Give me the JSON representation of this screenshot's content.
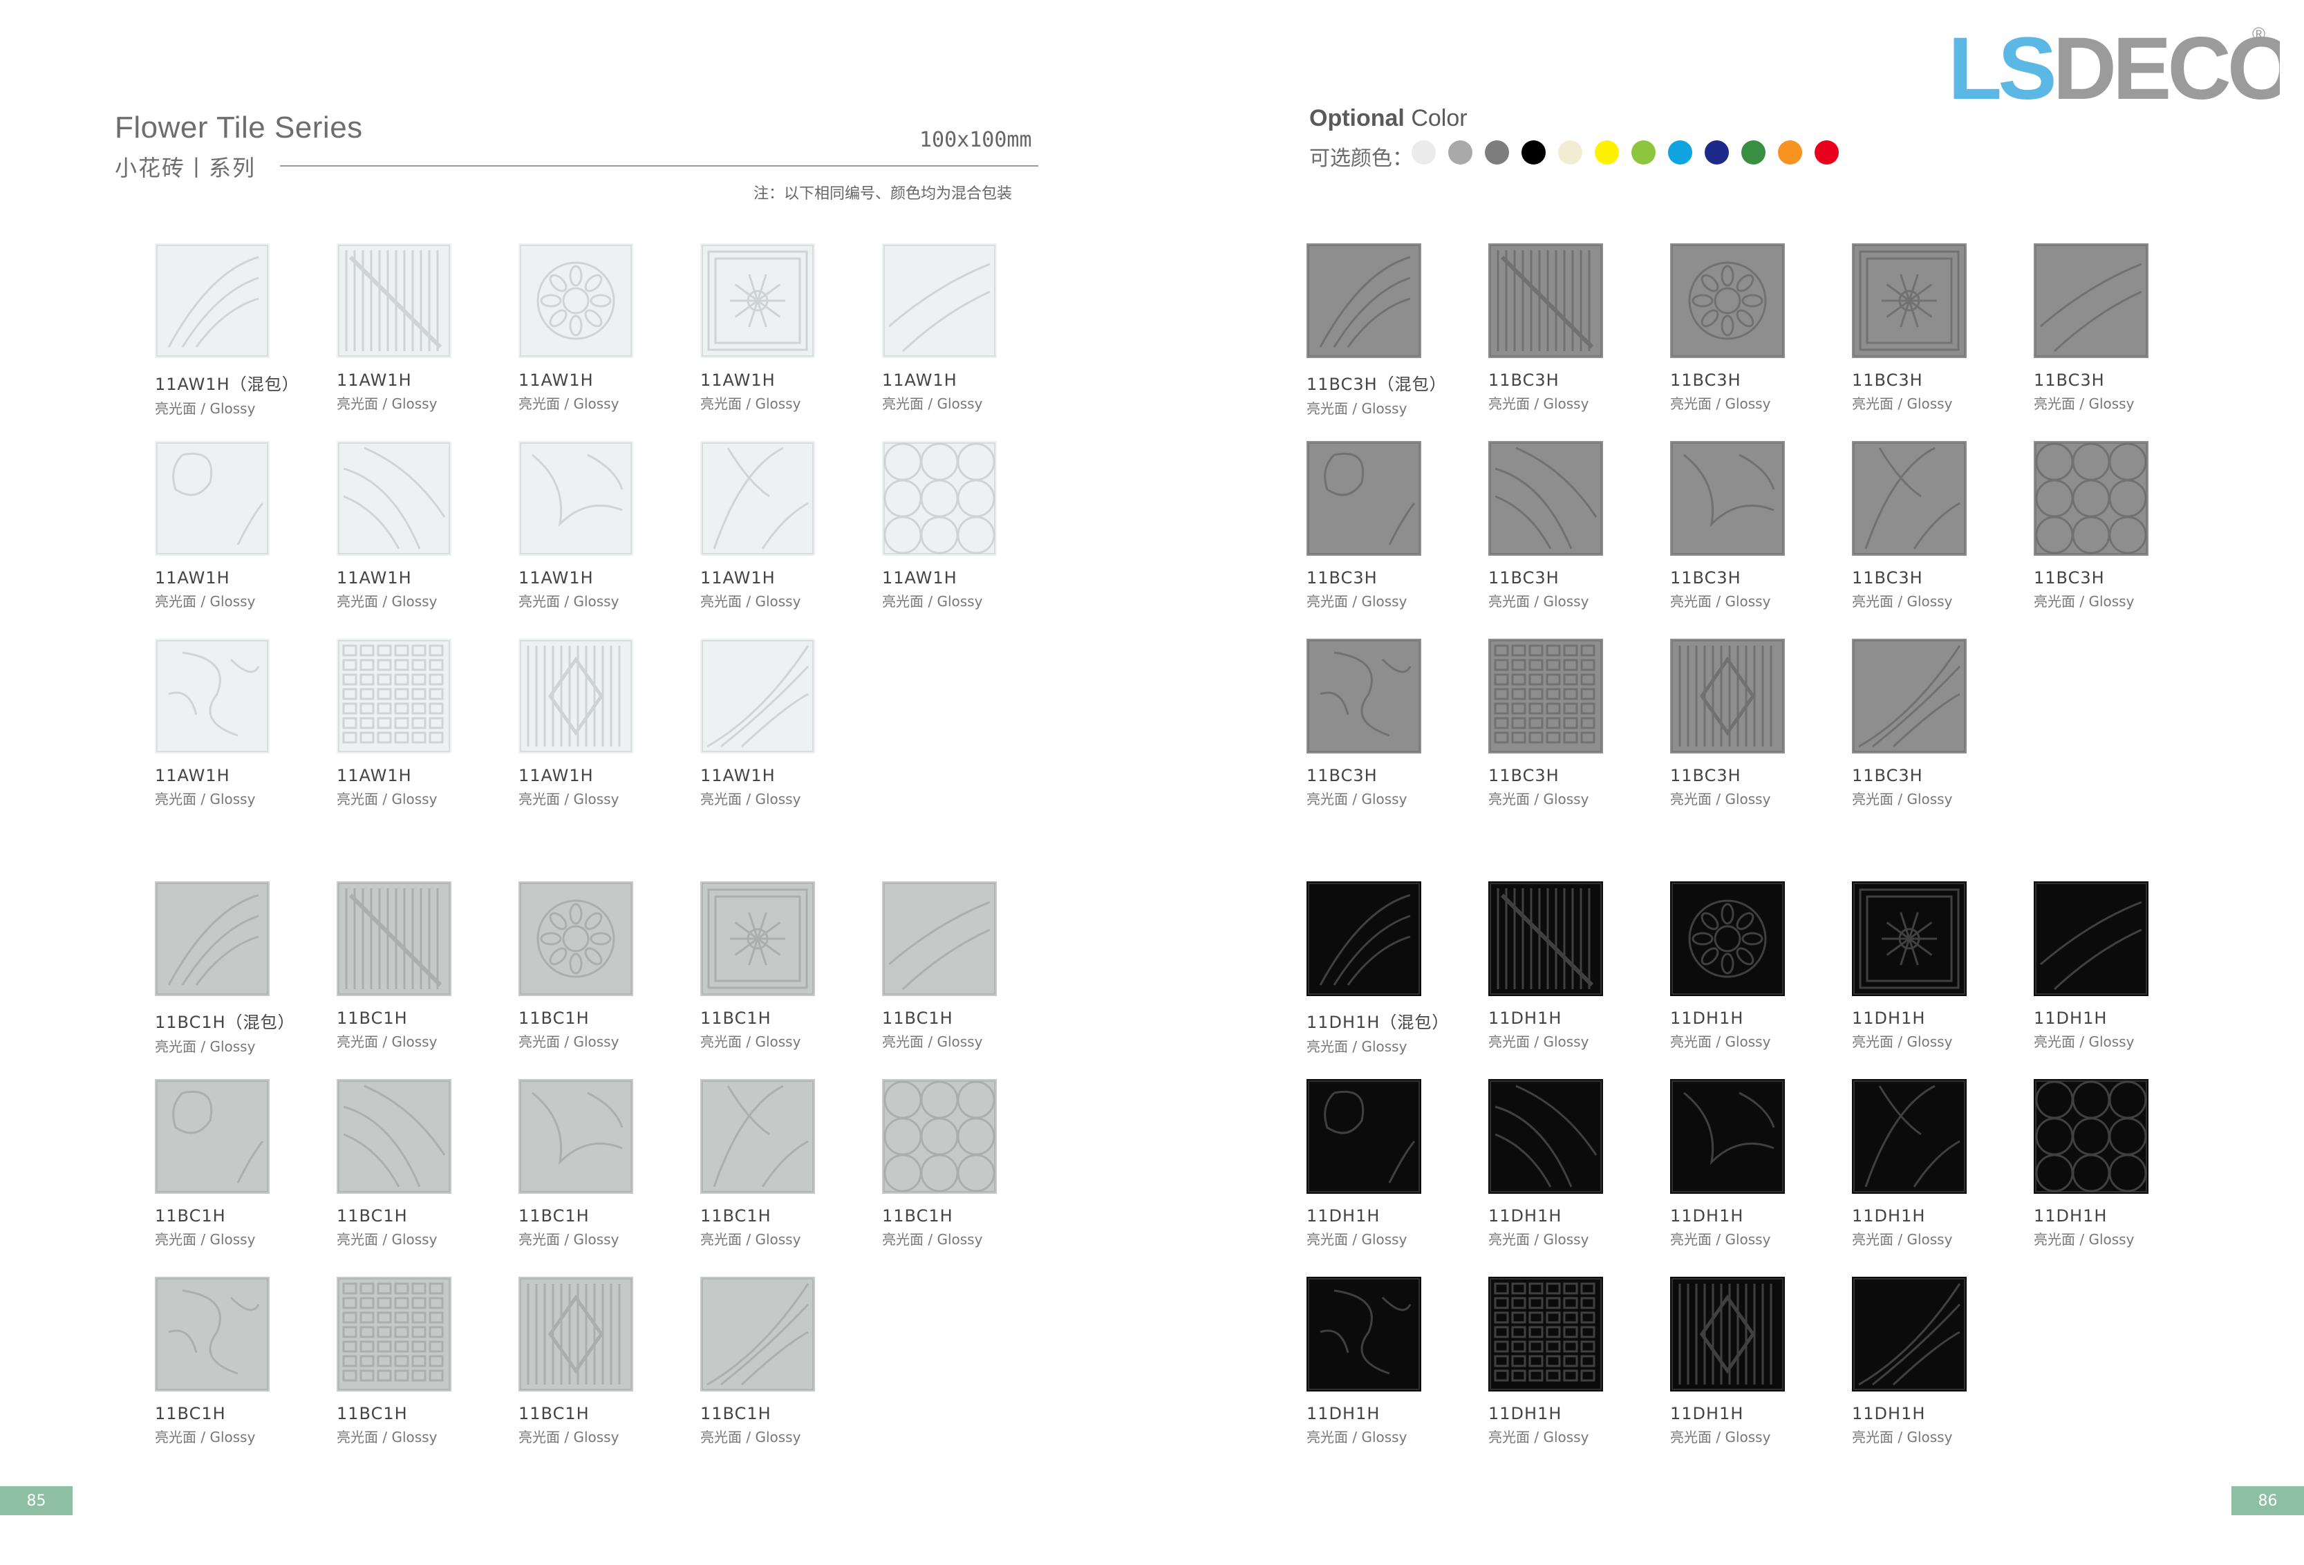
{
  "header": {
    "title_en": "Flower Tile Series",
    "title_cn": "小花砖丨系列",
    "size": "100x100mm",
    "note": "注：以下相同编号、颜色均为混合包装"
  },
  "optional_color": {
    "title_bold": "Optional",
    "title_rest": " Color",
    "label": "可选颜色：",
    "swatches": [
      "#ebebeb",
      "#a9a9a9",
      "#7d7d7d",
      "#000000",
      "#f3ecd2",
      "#fff200",
      "#8cc63f",
      "#0fa3e0",
      "#1e2a8a",
      "#3a8f43",
      "#f7931e",
      "#e8001c"
    ]
  },
  "logo": {
    "text": "LSDECO",
    "registered": "®",
    "color_letters": "#5bb8e5",
    "color_gray": "#9b9b9b"
  },
  "finish_label": "亮光面 / Glossy",
  "pages": {
    "left": "85",
    "right": "86"
  },
  "groups": [
    {
      "id": "aw",
      "tile_color": "#eef1f1",
      "pattern_color": "#c9d0d0",
      "rows": [
        [
          "11AW1H（混包）",
          "11AW1H",
          "11AW1H",
          "11AW1H",
          "11AW1H"
        ],
        [
          "11AW1H",
          "11AW1H",
          "11AW1H",
          "11AW1H",
          "11AW1H"
        ],
        [
          "11AW1H",
          "11AW1H",
          "11AW1H",
          "11AW1H"
        ]
      ]
    },
    {
      "id": "bc1",
      "tile_color": "#c5c9c8",
      "pattern_color": "#a6aaa9",
      "rows": [
        [
          "11BC1H（混包）",
          "11BC1H",
          "11BC1H",
          "11BC1H",
          "11BC1H"
        ],
        [
          "11BC1H",
          "11BC1H",
          "11BC1H",
          "11BC1H",
          "11BC1H"
        ],
        [
          "11BC1H",
          "11BC1H",
          "11BC1H",
          "11BC1H"
        ]
      ]
    },
    {
      "id": "bc3",
      "tile_color": "#8e8e8e",
      "pattern_color": "#6c6c6c",
      "rows": [
        [
          "11BC3H（混包）",
          "11BC3H",
          "11BC3H",
          "11BC3H",
          "11BC3H"
        ],
        [
          "11BC3H",
          "11BC3H",
          "11BC3H",
          "11BC3H",
          "11BC3H"
        ],
        [
          "11BC3H",
          "11BC3H",
          "11BC3H",
          "11BC3H"
        ]
      ]
    },
    {
      "id": "dh",
      "tile_color": "#0b0b0b",
      "pattern_color": "#4a4a4a",
      "rows": [
        [
          "11DH1H（混包）",
          "11DH1H",
          "11DH1H",
          "11DH1H",
          "11DH1H"
        ],
        [
          "11DH1H",
          "11DH1H",
          "11DH1H",
          "11DH1H",
          "11DH1H"
        ],
        [
          "11DH1H",
          "11DH1H",
          "11DH1H",
          "11DH1H"
        ]
      ]
    }
  ]
}
